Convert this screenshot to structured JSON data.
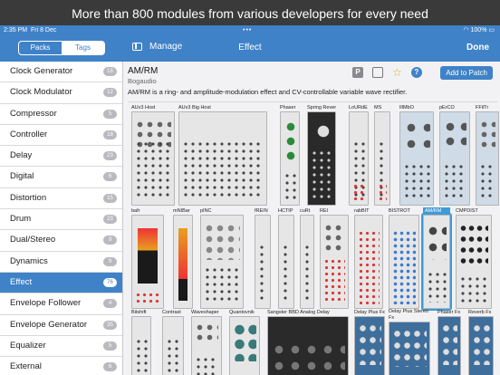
{
  "banner": "More than 800 modules from various developers for every need",
  "status": {
    "time": "2:35 PM",
    "date": "Fri 8 Dec",
    "battery": "100%"
  },
  "nav": {
    "packs": "Packs",
    "tags": "Tags",
    "manage": "Manage",
    "title": "Effect",
    "done": "Done"
  },
  "categories": [
    {
      "label": "Clock Generator",
      "count": "18"
    },
    {
      "label": "Clock Modulator",
      "count": "12"
    },
    {
      "label": "Compressor",
      "count": "5"
    },
    {
      "label": "Controller",
      "count": "18"
    },
    {
      "label": "Delay",
      "count": "23"
    },
    {
      "label": "Digital",
      "count": "6"
    },
    {
      "label": "Distortion",
      "count": "15"
    },
    {
      "label": "Drum",
      "count": "23"
    },
    {
      "label": "Dual/Stereo",
      "count": "9"
    },
    {
      "label": "Dynamics",
      "count": "9"
    },
    {
      "label": "Effect",
      "count": "76"
    },
    {
      "label": "Envelope Follower",
      "count": "4"
    },
    {
      "label": "Envelope Generator",
      "count": "35"
    },
    {
      "label": "Equalizer",
      "count": "5"
    },
    {
      "label": "External",
      "count": "6"
    }
  ],
  "module": {
    "title": "AM/RM",
    "vendor": "Bogaudio",
    "description": "AM/RM is a ring- and amplitude-modulation effect and CV-controllable variable wave rectifier.",
    "p_label": "P",
    "help": "?",
    "add_label": "Add to Patch"
  },
  "modules": [
    "AUv3 Host",
    "AUv3 Big Host",
    "Phaser",
    "Spring Reverb",
    "LoURdE",
    "MS",
    "lIlMbO",
    "pErCO",
    "FFilTr",
    "bafr",
    "mNIBar",
    "pINC",
    "fREIN",
    "HCTIP",
    "cuRt",
    "REl",
    "rabBIT",
    "BISTROT",
    "AM/RM",
    "CMPDIST",
    "Bitshift",
    "Contrast",
    "Waveshaper",
    "Quantovnik",
    "Sangster BBD Analog Delay",
    "Delay Plus Fx",
    "Delay Plus Stereo Fx",
    "Phaser Fx",
    "Reverb Fx"
  ]
}
